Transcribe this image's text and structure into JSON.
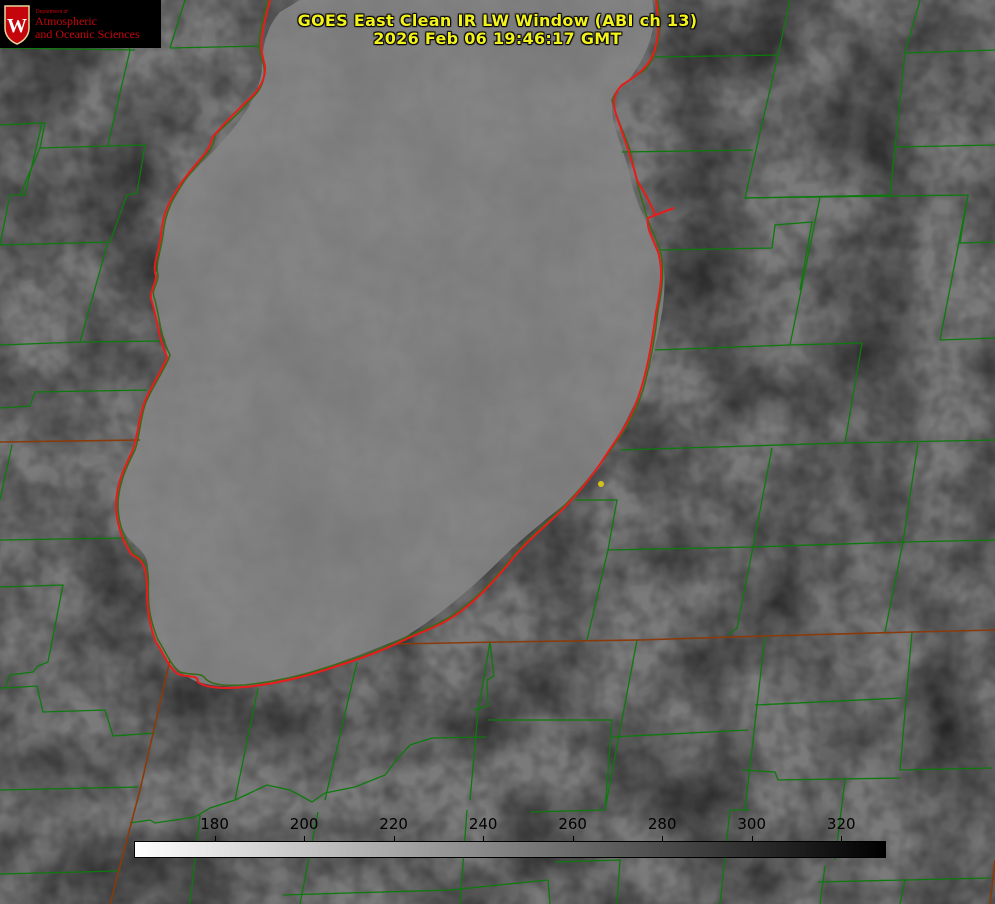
{
  "title": {
    "line1": "GOES East Clean IR LW Window (ABI ch 13)",
    "line2": "2026 Feb 06 19:46:17 GMT"
  },
  "logo": {
    "department": "Department of",
    "line1": "Atmospheric",
    "line2": "and Oceanic Sciences",
    "crest_letter": "W"
  },
  "colorbar": {
    "min": 162,
    "max": 330,
    "ticks": [
      180,
      200,
      220,
      240,
      260,
      280,
      300,
      320
    ],
    "gradient": [
      "#ffffff",
      "#000000"
    ]
  },
  "colors": {
    "lake_outline": "#e81c1c",
    "county_lines": "#0d7a0d",
    "state_line": "#8a3a0a",
    "marker": "#d4c21a",
    "title_text": "#f2f21c",
    "logo_text": "#c5050c"
  }
}
